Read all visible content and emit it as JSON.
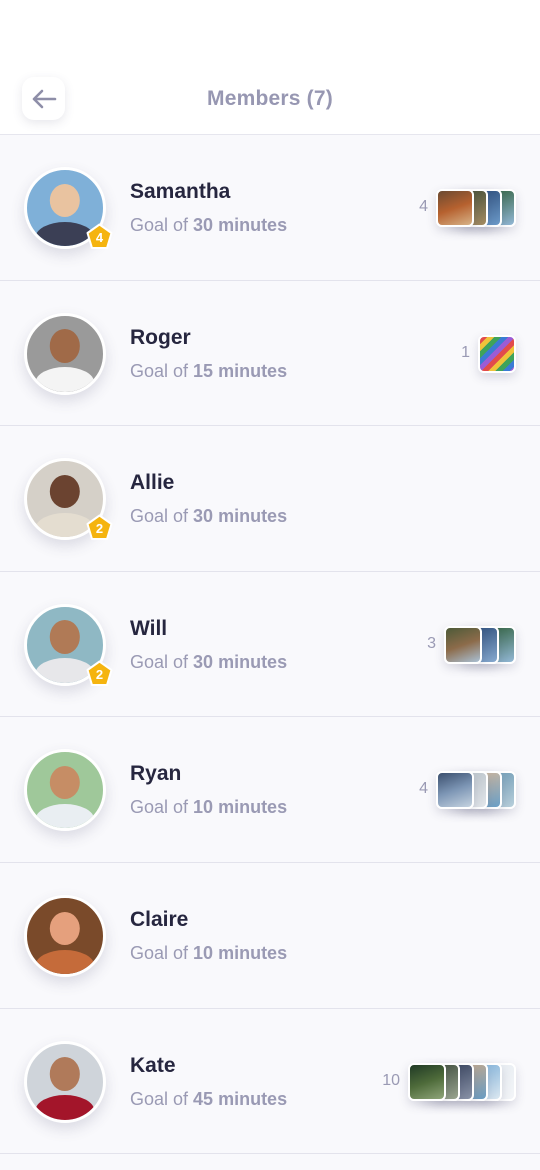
{
  "header": {
    "title": "Members (7)",
    "back_icon": "arrow-left-icon"
  },
  "members": [
    {
      "name": "Samantha",
      "goal_prefix": "Goal of ",
      "goal_value": "30 minutes",
      "badge": "4",
      "count": "4",
      "avatar_colors": [
        "#7fb0d8",
        "#e9c3a0",
        "#3b3f55"
      ],
      "cards": [
        [
          "#6b4a32",
          "#b6612f",
          "#d7b388"
        ],
        [
          "#3f4c36",
          "#a58c62"
        ],
        [
          "#2b4b78",
          "#6c9ac9"
        ],
        [
          "#2f5f3a",
          "#93b8d6"
        ]
      ]
    },
    {
      "name": "Roger",
      "goal_prefix": "Goal of ",
      "goal_value": "15 minutes",
      "badge": "",
      "count": "1",
      "avatar_colors": [
        "#9a9a9a",
        "#a06a48",
        "#f4f4f4"
      ],
      "cards": [
        [
          "#e24b4b",
          "#f0c33a",
          "#3fa35a",
          "#3a7bd5",
          "#9b5cd6"
        ]
      ]
    },
    {
      "name": "Allie",
      "goal_prefix": "Goal of ",
      "goal_value": "30 minutes",
      "badge": "2",
      "count": "",
      "avatar_colors": [
        "#d5d0c8",
        "#6b4330",
        "#e4ddd0"
      ],
      "cards": []
    },
    {
      "name": "Will",
      "goal_prefix": "Goal of ",
      "goal_value": "30 minutes",
      "badge": "2",
      "count": "3",
      "avatar_colors": [
        "#8fb8c4",
        "#b07a56",
        "#e7e7ea"
      ],
      "cards": [
        [
          "#4d5a38",
          "#8c6b4a",
          "#a9c0d4"
        ],
        [
          "#2b4b78",
          "#86a9cf"
        ],
        [
          "#2f5f3a",
          "#93b8d6"
        ]
      ]
    },
    {
      "name": "Ryan",
      "goal_prefix": "Goal of ",
      "goal_value": "10 minutes",
      "badge": "",
      "count": "4",
      "avatar_colors": [
        "#9fc89a",
        "#c68d65",
        "#e9eef2"
      ],
      "cards": [
        [
          "#3b4f6e",
          "#7d96b5",
          "#c5d3e0"
        ],
        [
          "#b9c2c9",
          "#e2e6ea"
        ],
        [
          "#d6b89a",
          "#6aa0c8"
        ],
        [
          "#6f9bb5",
          "#b8cfdb"
        ]
      ]
    },
    {
      "name": "Claire",
      "goal_prefix": "Goal of ",
      "goal_value": "10 minutes",
      "badge": "",
      "count": "",
      "avatar_colors": [
        "#7a4a2a",
        "#e5a07d",
        "#c56b3a"
      ],
      "cards": []
    },
    {
      "name": "Kate",
      "goal_prefix": "Goal of ",
      "goal_value": "45 minutes",
      "badge": "",
      "count": "10",
      "avatar_colors": [
        "#cfd4da",
        "#b07a5a",
        "#a3152a"
      ],
      "cards": [
        [
          "#203a25",
          "#4e6b3a",
          "#8fa57a"
        ],
        [
          "#3c4a3a",
          "#9aa590"
        ],
        [
          "#34405a",
          "#8a93a8"
        ],
        [
          "#c8a98a",
          "#6a9dc4"
        ],
        [
          "#7fb0d8",
          "#dbe8f1"
        ],
        [
          "#e8edf2",
          "#f3f5f8"
        ]
      ]
    }
  ],
  "colors": {
    "badge": "#f5b40f",
    "title": "#9797b2",
    "name": "#26263f",
    "muted": "#9a9ab4",
    "divider": "#e3e3ec"
  }
}
